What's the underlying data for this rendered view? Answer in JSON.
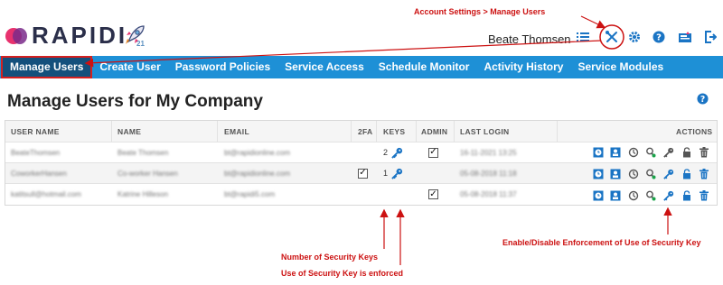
{
  "header": {
    "brand": "RAPIDI",
    "version": "21",
    "user_name": "Beate Thomsen"
  },
  "nav": {
    "items": [
      {
        "label": "Manage Users"
      },
      {
        "label": "Create User"
      },
      {
        "label": "Password Policies"
      },
      {
        "label": "Service Access"
      },
      {
        "label": "Schedule Monitor"
      },
      {
        "label": "Activity History"
      },
      {
        "label": "Service Modules"
      }
    ]
  },
  "page": {
    "title": "Manage Users for My Company"
  },
  "table": {
    "columns": [
      "USER NAME",
      "NAME",
      "EMAIL",
      "2FA",
      "KEYS",
      "ADMIN",
      "LAST LOGIN",
      "ACTIONS"
    ],
    "rows": [
      {
        "user_name": "BeateThomsen",
        "name": "Beate Thomsen",
        "email": "bt@rapidionline.com",
        "two_fa": false,
        "keys": "2",
        "admin": true,
        "last_login": "16-11-2021 13:25"
      },
      {
        "user_name": "CoworkerHansen",
        "name": "Co-worker Hansen",
        "email": "bt@rapidionline.com",
        "two_fa": true,
        "keys": "1",
        "admin": false,
        "last_login": "05-08-2018 11:18"
      },
      {
        "user_name": "katitsull@hotmail.com",
        "name": "Katrine Hilleson",
        "email": "bt@rapidi5.com",
        "two_fa": false,
        "keys": "",
        "admin": true,
        "last_login": "05-08-2018 11:37"
      }
    ]
  },
  "annotations": {
    "account_settings": "Account Settings > Manage Users",
    "number_of_keys": "Number of Security Keys",
    "key_enforced": "Use of Security Key is enforced",
    "enable_disable": "Enable/Disable Enforcement of Use of Security Key"
  },
  "colors": {
    "nav_bg": "#1e90d6",
    "nav_active": "#14507c",
    "annotation": "#cc1111",
    "icon_blue": "#1a74c4"
  }
}
